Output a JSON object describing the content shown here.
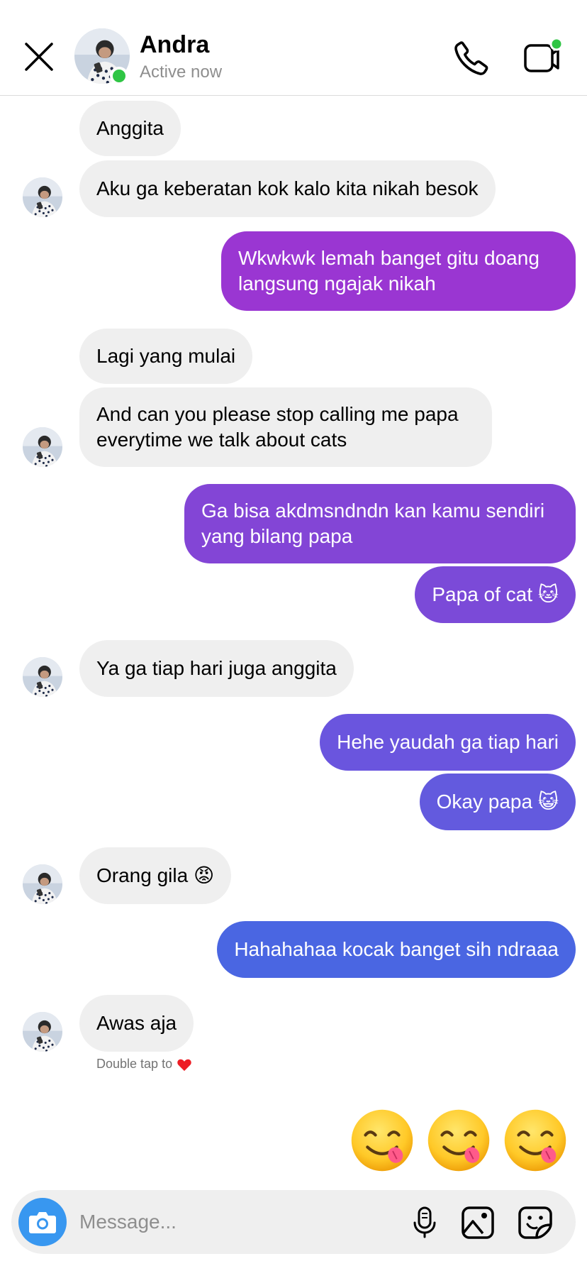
{
  "header": {
    "name": "Andra",
    "status": "Active now"
  },
  "colors": {
    "incoming_bubble": "#efefef",
    "outgoing_gradient": [
      "#9a36d2",
      "#8345d6",
      "#6a55de",
      "#4a66e2"
    ],
    "online": "#2fc544",
    "camera_button": "#3897f0"
  },
  "messages": [
    {
      "from": "them",
      "text": "Anggita"
    },
    {
      "from": "them",
      "text": "Aku ga keberatan kok kalo kita nikah besok"
    },
    {
      "from": "me",
      "text": "Wkwkwk lemah banget gitu doang langsung ngajak nikah"
    },
    {
      "from": "them",
      "text": "Lagi yang mulai"
    },
    {
      "from": "them",
      "text": "And can you please stop calling me papa everytime we talk about cats"
    },
    {
      "from": "me",
      "text": "Ga bisa akdmsndndn kan kamu sendiri yang bilang papa"
    },
    {
      "from": "me",
      "text": "Papa of cat 🐱"
    },
    {
      "from": "them",
      "text": "Ya ga tiap hari juga anggita"
    },
    {
      "from": "me",
      "text": "Hehe yaudah ga tiap hari"
    },
    {
      "from": "me",
      "text": "Okay papa 😺"
    },
    {
      "from": "them",
      "text": "Orang gila 😡"
    },
    {
      "from": "me",
      "text": "Hahahahaa kocak banget sih ndraaa"
    },
    {
      "from": "them",
      "text": "Awas aja"
    }
  ],
  "hint": {
    "text": "Double tap to",
    "icon": "heart-icon"
  },
  "quick_reactions": [
    "face-savoring-food-emoji",
    "face-savoring-food-emoji",
    "face-savoring-food-emoji"
  ],
  "composer": {
    "placeholder": "Message..."
  }
}
